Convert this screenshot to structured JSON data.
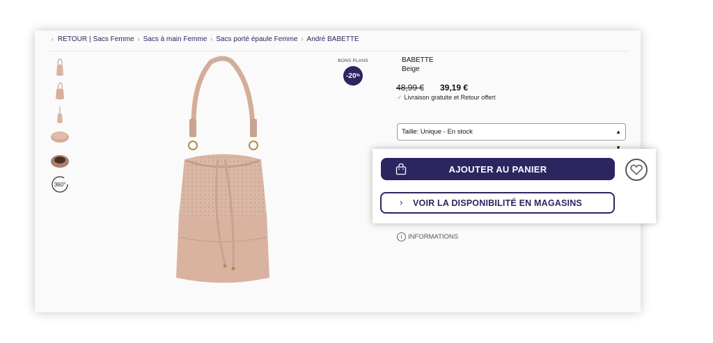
{
  "breadcrumb": {
    "back_label": "RETOUR",
    "separator": "|",
    "items": [
      "Sacs Femme",
      "Sacs à main Femme",
      "Sacs porté épaule Femme",
      "André BABETTE"
    ]
  },
  "thumbnails": [
    {
      "icon": "bag-front-thumbnail"
    },
    {
      "icon": "bag-angle-thumbnail"
    },
    {
      "icon": "bag-side-thumbnail"
    },
    {
      "icon": "bag-bottom-thumbnail"
    },
    {
      "icon": "bag-inside-thumbnail"
    },
    {
      "icon": "view-360-icon",
      "label": "360°"
    }
  ],
  "promo": {
    "label": "BONS PLANS",
    "discount": "-20",
    "unit": "%"
  },
  "product": {
    "brand": "BABETTE",
    "color": "Beige",
    "old_price": "48,99 €",
    "new_price": "39,19 €",
    "shipping": "Livraison gratuite et Retour offert",
    "size_select": "Taille: Unique - En stock"
  },
  "actions": {
    "add_to_cart": "AJOUTER AU PANIER",
    "store_availability": "VOIR LA DISPONIBILITÉ EN MAGASINS"
  },
  "info": {
    "label": "INFORMATIONS"
  },
  "colors": {
    "brand": "#2b2560",
    "bag": "#d9b4a2",
    "check": "#7cb342"
  }
}
